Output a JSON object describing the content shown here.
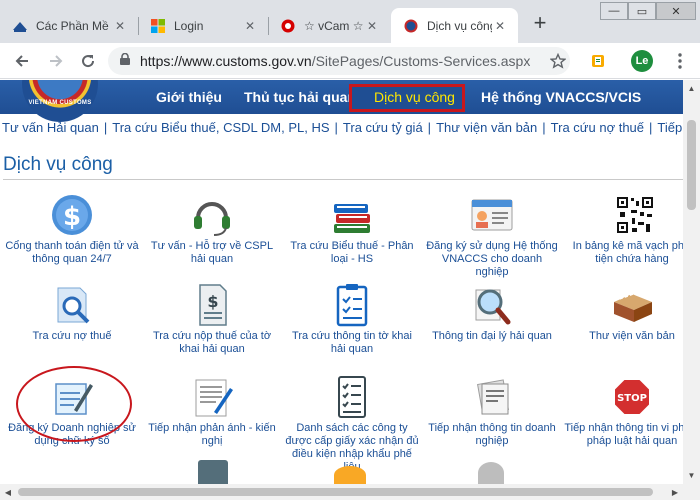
{
  "browser": {
    "tabs": [
      {
        "title": "Các Phần Mề",
        "icon": "site-favicon"
      },
      {
        "title": "Login",
        "icon": "windows-favicon"
      },
      {
        "title": "☆ vCam ☆ C",
        "icon": "red-circle-favicon"
      },
      {
        "title": "Dịch vụ công",
        "icon": "customs-favicon"
      }
    ],
    "address": {
      "prefix": "https://www.customs.gov.vn",
      "path": "/SitePages/Customs-Services.aspx"
    },
    "avatar": "Le"
  },
  "site": {
    "logo_text": "VIETNAM CUSTOMS",
    "nav": [
      "Giới thiệu",
      "Thủ tục hải quan",
      "Dịch vụ công",
      "Hệ thống VNACCS/VCIS"
    ],
    "sublinks": [
      "Tư vấn Hải quan",
      "Tra cứu Biểu thuế, CSDL DM, PL, HS",
      "Tra cứu tỷ giá",
      "Thư viện văn bản",
      "Tra cứu nợ thuế",
      "Tiếp nhận t"
    ],
    "heading": "Dịch vụ công"
  },
  "services": [
    {
      "label": "Cổng thanh toán điện tử và thông quan 24/7",
      "icon": "dollar-icon"
    },
    {
      "label": "Tư vấn - Hỗ trợ về CSPL hải quan",
      "icon": "headset-icon"
    },
    {
      "label": "Tra cứu Biểu thuế - Phân loại - HS",
      "icon": "books-icon"
    },
    {
      "label": "Đăng ký sử dụng Hệ thống VNACCS cho doanh nghiệp",
      "icon": "id-card-icon"
    },
    {
      "label": "In bảng kê mã vạch phư tiện chứa hàng",
      "icon": "qr-code-icon"
    },
    {
      "label": "Tra cứu nợ thuế",
      "icon": "search-document-icon"
    },
    {
      "label": "Tra cứu nộp thuế của tờ khai hải quan",
      "icon": "tax-document-icon"
    },
    {
      "label": "Tra cứu thông tin tờ khai hải quan",
      "icon": "clipboard-icon"
    },
    {
      "label": "Thông tin đại lý hải quan",
      "icon": "magnifier-icon"
    },
    {
      "label": "Thư viện văn bản",
      "icon": "card-drawer-icon"
    },
    {
      "label": "Đăng ký Doanh nghiệp sử dụng chữ ký số",
      "icon": "notepad-pen-icon"
    },
    {
      "label": "Tiếp nhận phản ánh - kiến nghị",
      "icon": "feedback-pen-icon"
    },
    {
      "label": "Danh sách các công ty được cấp giấy xác nhận đủ điều kiện nhập khẩu phế liệu",
      "icon": "checklist-icon"
    },
    {
      "label": "Tiếp nhận thông tin doanh nghiệp",
      "icon": "documents-icon"
    },
    {
      "label": "Tiếp nhận thông tin vi phạm pháp luật hải quan",
      "icon": "stop-sign-icon"
    }
  ],
  "colors": {
    "brand_blue": "#1f4e93",
    "link_blue": "#1b4f96",
    "accent_yellow": "#ffe600",
    "highlight_red": "#c8171d"
  }
}
